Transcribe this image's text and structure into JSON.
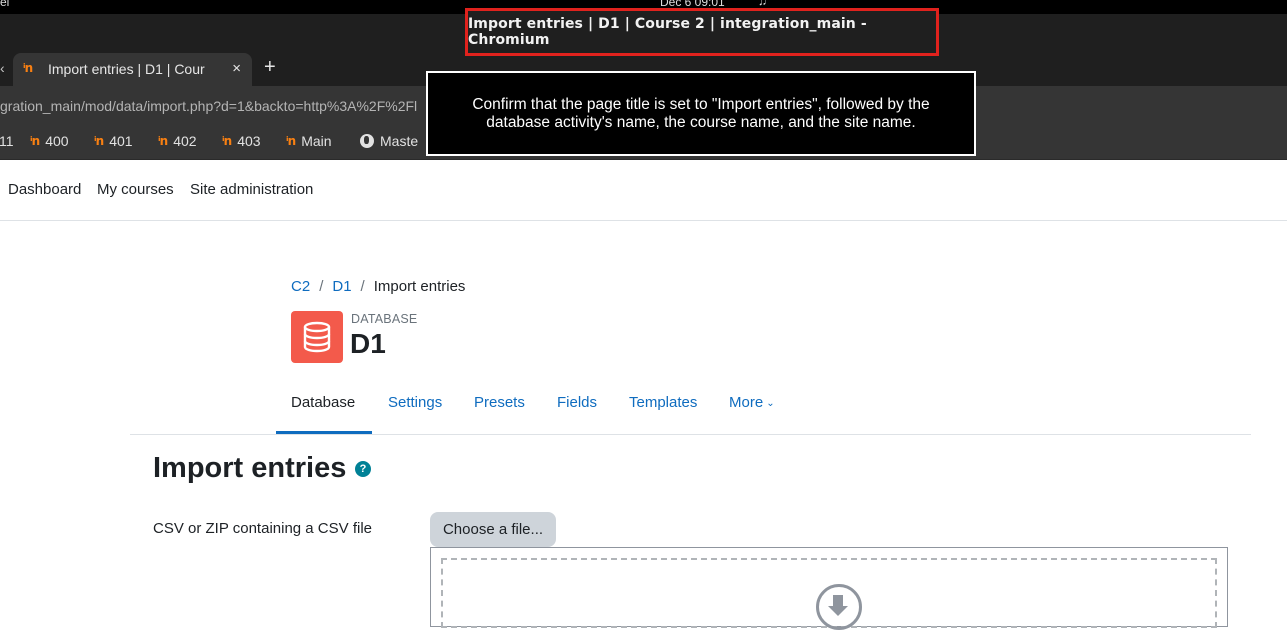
{
  "os": {
    "app_fragment": "el",
    "clock": "Dec 6  09:01"
  },
  "window": {
    "title": "Import entries | D1 | Course 2 | integration_main - Chromium"
  },
  "tabs": {
    "stub": "‹",
    "active_tab": "Import entries | D1 | Cour",
    "close": "×",
    "new_tab": "+"
  },
  "address": {
    "url": "gration_main/mod/data/import.php?d=1&backto=http%3A%2F%2Fl"
  },
  "bookmarks": [
    {
      "label": "11",
      "icon": "none"
    },
    {
      "label": "400",
      "icon": "moodle-icon"
    },
    {
      "label": "401",
      "icon": "moodle-icon"
    },
    {
      "label": "402",
      "icon": "moodle-icon"
    },
    {
      "label": "403",
      "icon": "moodle-icon"
    },
    {
      "label": "Main",
      "icon": "moodle-icon"
    },
    {
      "label": "Maste",
      "icon": "globe-icon"
    }
  ],
  "tooltip": {
    "text": "Confirm that the page title is set to \"Import entries\", followed by the database activity's name, the course name, and the site name."
  },
  "navbar": {
    "dashboard": "Dashboard",
    "my_courses": "My courses",
    "site_admin": "Site administration"
  },
  "breadcrumb": {
    "course": "C2",
    "activity": "D1",
    "current": "Import entries",
    "separator": "/"
  },
  "activity": {
    "type_label": "DATABASE",
    "name": "D1",
    "icon": "database-icon",
    "icon_color": "#f35a4b"
  },
  "secondary_nav": {
    "database": "Database",
    "settings": "Settings",
    "presets": "Presets",
    "fields": "Fields",
    "templates": "Templates",
    "more": "More"
  },
  "main": {
    "heading": "Import entries",
    "help_icon": "?",
    "file_label": "CSV or ZIP containing a CSV file",
    "choose_button": "Choose a file..."
  },
  "colors": {
    "link": "#0f6cbf",
    "title_highlight": "#e0221d",
    "help": "#008196"
  }
}
